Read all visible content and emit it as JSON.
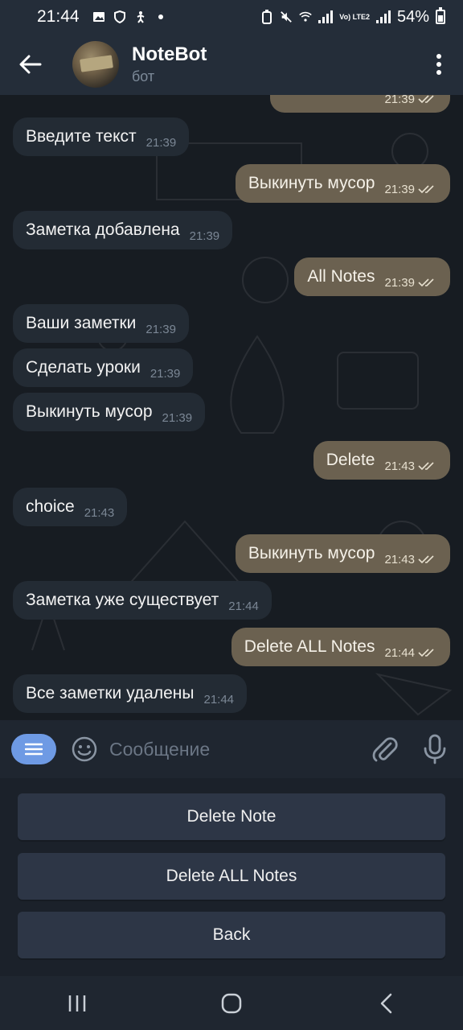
{
  "status_bar": {
    "time": "21:44",
    "battery": "54%",
    "network_label": "Vo) LTE2",
    "icons": [
      "gallery-icon",
      "shield-icon",
      "accessibility-icon",
      "dot-icon",
      "data-saver-icon",
      "mute-icon",
      "wifi-icon",
      "signal-icon",
      "battery-icon"
    ]
  },
  "header": {
    "title": "NoteBot",
    "subtitle": "бот",
    "icons": [
      "back-arrow-icon",
      "avatar",
      "more-vertical-icon"
    ]
  },
  "messages": [
    {
      "dir": "out",
      "text": "",
      "time": "21:39",
      "ticks": true
    },
    {
      "dir": "in",
      "text": "Введите текст",
      "time": "21:39"
    },
    {
      "dir": "out",
      "text": "Выкинуть мусор",
      "time": "21:39",
      "ticks": true
    },
    {
      "dir": "in",
      "text": "Заметка добавлена",
      "time": "21:39"
    },
    {
      "dir": "out",
      "text": "All Notes",
      "time": "21:39",
      "ticks": true
    },
    {
      "dir": "in",
      "text": "Ваши заметки",
      "time": "21:39"
    },
    {
      "dir": "in",
      "text": "Сделать уроки",
      "time": "21:39"
    },
    {
      "dir": "in",
      "text": "Выкинуть мусор",
      "time": "21:39"
    },
    {
      "dir": "out",
      "text": "Delete",
      "time": "21:43",
      "ticks": true
    },
    {
      "dir": "in",
      "text": "choice",
      "time": "21:43"
    },
    {
      "dir": "out",
      "text": "Выкинуть мусор",
      "time": "21:43",
      "ticks": true
    },
    {
      "dir": "in",
      "text": "Заметка уже существует",
      "time": "21:44"
    },
    {
      "dir": "out",
      "text": "Delete ALL Notes",
      "time": "21:44",
      "ticks": true
    },
    {
      "dir": "in",
      "text": "Все заметки удалены",
      "time": "21:44"
    }
  ],
  "composer": {
    "placeholder": "Сообщение",
    "icons": [
      "bot-menu-icon",
      "emoji-icon",
      "attach-icon",
      "mic-icon"
    ]
  },
  "keyboard": {
    "buttons": [
      "Delete Note",
      "Delete ALL Notes",
      "Back"
    ]
  },
  "navbar": {
    "icons": [
      "recent-apps-icon",
      "home-icon",
      "back-icon"
    ]
  },
  "colors": {
    "bar_bg": "#242d39",
    "incoming_bubble": "#232b34",
    "outgoing_bubble": "#6b6150",
    "accent": "#6e9ae4",
    "keyboard_button": "#2d3646"
  }
}
